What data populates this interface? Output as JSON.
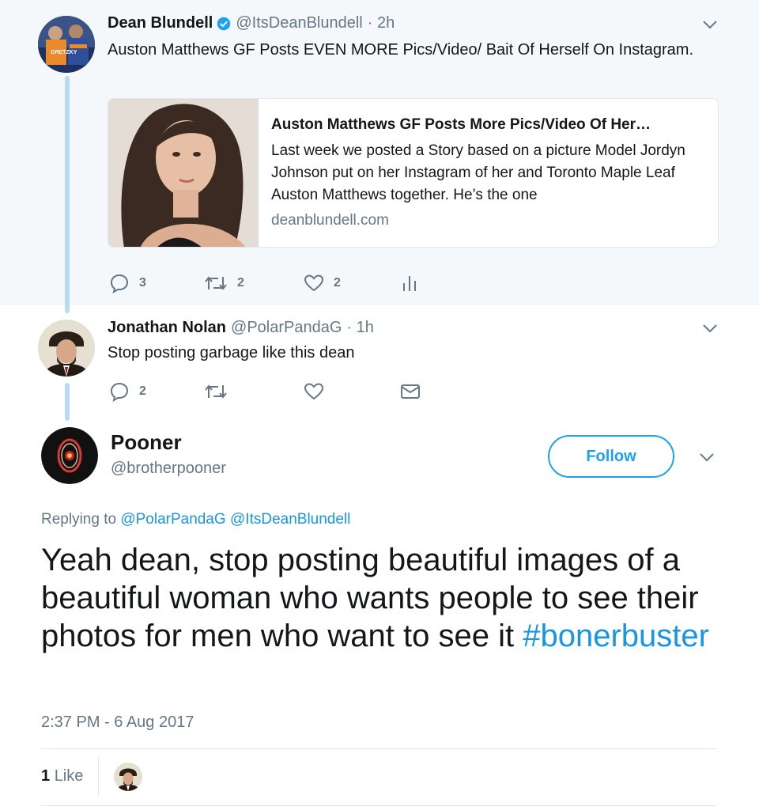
{
  "tweet1": {
    "name": "Dean Blundell",
    "handle": "@ItsDeanBlundell",
    "time": "· 2h",
    "text": "Auston Matthews GF Posts EVEN MORE Pics/Video/ Bait Of Herself On Instagram.",
    "card": {
      "title": "Auston Matthews GF Posts More Pics/Video Of Her…",
      "description": "Last week we posted a Story based on a picture Model Jordyn Johnson put on her Instagram of her and Toronto Maple Leaf  Auston Matthews together.   He’s the one",
      "domain": "deanblundell.com"
    },
    "actions": {
      "replies": "3",
      "retweets": "2",
      "likes": "2"
    },
    "avatar_jersey_text": "GRETZKY"
  },
  "tweet2": {
    "name": "Jonathan Nolan",
    "handle": "@PolarPandaG",
    "time": "· 1h",
    "text": "Stop posting garbage like this dean",
    "actions": {
      "replies": "2"
    }
  },
  "main": {
    "name": "Pooner",
    "handle": "@brotherpooner",
    "follow_label": "Follow",
    "replying_prefix": "Replying to",
    "mention1": "@PolarPandaG",
    "mention2": "@ItsDeanBlundell",
    "text": "Yeah dean, stop posting beautiful images of a beautiful woman who wants people to see their photos for men who want to see it ",
    "hashtag": "#bonerbuster",
    "timestamp": "2:37 PM - 6 Aug 2017",
    "like_count": "1",
    "like_label": "Like"
  },
  "colors": {
    "accent": "#1da1f2",
    "link": "#1b95e0",
    "secondary_text": "#657786",
    "context_bg": "#f5f8fa",
    "thread_line": "#b9daf2"
  },
  "icons": [
    "verified-badge-icon",
    "chevron-down-icon",
    "reply-icon",
    "retweet-icon",
    "heart-icon",
    "analytics-icon",
    "direct-message-icon"
  ]
}
